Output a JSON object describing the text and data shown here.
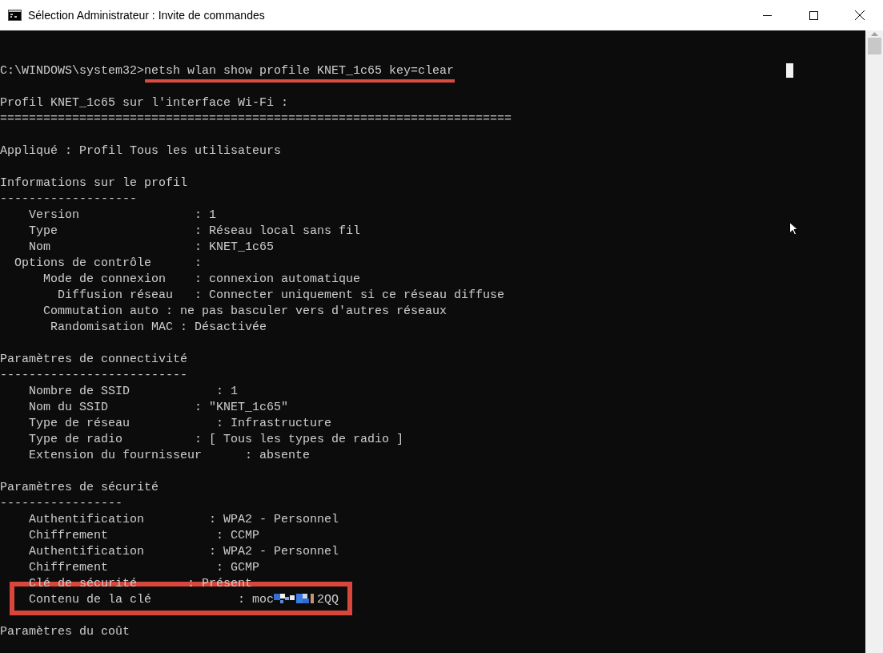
{
  "window": {
    "title": "Sélection Administrateur : Invite de commandes"
  },
  "console": {
    "lines": [
      {
        "kind": "command",
        "prompt": "C:\\WINDOWS\\system32>",
        "text": "netsh wlan show profile KNET_1c65 key=clear",
        "underlined": true
      },
      {
        "kind": "blank"
      },
      {
        "kind": "text",
        "text": "Profil KNET_1c65 sur l'interface Wi-Fi :"
      },
      {
        "kind": "text",
        "text": "======================================================================="
      },
      {
        "kind": "blank"
      },
      {
        "kind": "text",
        "text": "Appliqué : Profil Tous les utilisateurs"
      },
      {
        "kind": "blank"
      },
      {
        "kind": "text",
        "text": "Informations sur le profil"
      },
      {
        "kind": "text",
        "text": "-------------------"
      },
      {
        "kind": "text",
        "text": "    Version                : 1"
      },
      {
        "kind": "text",
        "text": "    Type                   : Réseau local sans fil"
      },
      {
        "kind": "text",
        "text": "    Nom                    : KNET_1c65"
      },
      {
        "kind": "text",
        "text": "  Options de contrôle      :"
      },
      {
        "kind": "text",
        "text": "      Mode de connexion    : connexion automatique"
      },
      {
        "kind": "text",
        "text": "        Diffusion réseau   : Connecter uniquement si ce réseau diffuse"
      },
      {
        "kind": "text",
        "text": "      Commutation auto : ne pas basculer vers d'autres réseaux"
      },
      {
        "kind": "text",
        "text": "       Randomisation MAC : Désactivée"
      },
      {
        "kind": "blank"
      },
      {
        "kind": "text",
        "text": "Paramètres de connectivité"
      },
      {
        "kind": "text",
        "text": "--------------------------"
      },
      {
        "kind": "text",
        "text": "    Nombre de SSID            : 1"
      },
      {
        "kind": "text",
        "text": "    Nom du SSID            : \"KNET_1c65\""
      },
      {
        "kind": "text",
        "text": "    Type de réseau            : Infrastructure"
      },
      {
        "kind": "text",
        "text": "    Type de radio          : [ Tous les types de radio ]"
      },
      {
        "kind": "text",
        "text": "    Extension du fournisseur      : absente"
      },
      {
        "kind": "blank"
      },
      {
        "kind": "text",
        "text": "Paramètres de sécurité"
      },
      {
        "kind": "text",
        "text": "-----------------"
      },
      {
        "kind": "text",
        "text": "    Authentification         : WPA2 - Personnel"
      },
      {
        "kind": "text",
        "text": "    Chiffrement               : CCMP"
      },
      {
        "kind": "text",
        "text": "    Authentification         : WPA2 - Personnel"
      },
      {
        "kind": "text",
        "text": "    Chiffrement               : GCMP"
      },
      {
        "kind": "text",
        "text": "    Clé de sécurité       : Présent"
      },
      {
        "kind": "key",
        "label": "    Contenu de la clé            :",
        "value_start": "moc",
        "value_end": "2QQ",
        "boxed": true
      },
      {
        "kind": "blank"
      },
      {
        "kind": "text",
        "text": "Paramètres du coût"
      }
    ]
  }
}
